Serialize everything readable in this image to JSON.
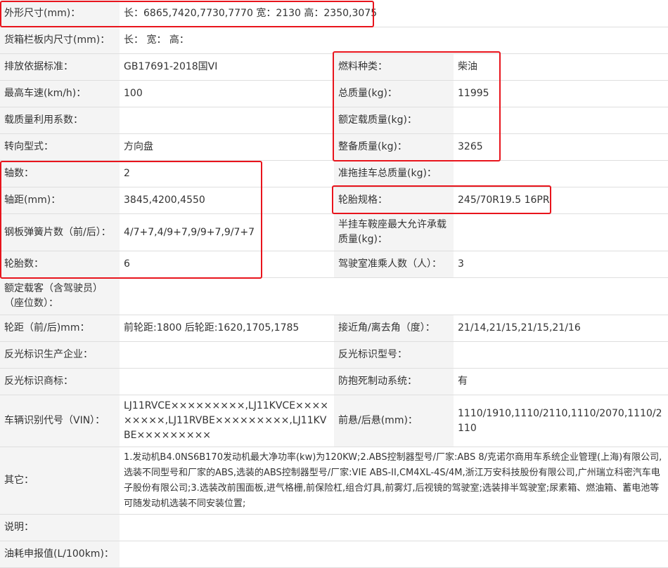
{
  "rows": {
    "r0": {
      "l1": "外形尺寸(mm)：",
      "v1": "长：6865,7420,7730,7770 宽：2130 高：2350,3075"
    },
    "r1": {
      "l1": "货箱栏板内尺寸(mm)：",
      "v1": "长： 宽： 高："
    },
    "r2": {
      "l1": "排放依据标准：",
      "v1": "GB17691-2018国VI",
      "l2": "燃料种类：",
      "v2": "柴油"
    },
    "r3": {
      "l1": "最高车速(km/h)：",
      "v1": "100",
      "l2": "总质量(kg)：",
      "v2": "11995"
    },
    "r4": {
      "l1": "载质量利用系数：",
      "v1": "",
      "l2": "额定载质量(kg)：",
      "v2": ""
    },
    "r5": {
      "l1": "转向型式：",
      "v1": "方向盘",
      "l2": "整备质量(kg)：",
      "v2": "3265"
    },
    "r6": {
      "l1": "轴数：",
      "v1": "2",
      "l2": "准拖挂车总质量(kg)：",
      "v2": ""
    },
    "r7": {
      "l1": "轴距(mm)：",
      "v1": "3845,4200,4550",
      "l2": "轮胎规格：",
      "v2": "245/70R19.5 16PR"
    },
    "r8": {
      "l1": "钢板弹簧片数（前/后）：",
      "v1": "4/7+7,4/9+7,9/9+7,9/7+7",
      "l2": "半挂车鞍座最大允许承载质量(kg)：",
      "v2": ""
    },
    "r9": {
      "l1": "轮胎数：",
      "v1": "6",
      "l2": "驾驶室准乘人数（人）：",
      "v2": "3"
    },
    "r10": {
      "l1": "额定载客（含驾驶员）（座位数）：",
      "v1": ""
    },
    "r11": {
      "l1": "轮距（前/后)mm：",
      "v1": "前轮距:1800 后轮距:1620,1705,1785",
      "l2": "接近角/离去角（度）：",
      "v2": "21/14,21/15,21/15,21/16"
    },
    "r12": {
      "l1": "反光标识生产企业：",
      "v1": "",
      "l2": "反光标识型号：",
      "v2": ""
    },
    "r13": {
      "l1": "反光标识商标：",
      "v1": "",
      "l2": "防抱死制动系统：",
      "v2": "有"
    },
    "r14": {
      "l1": "车辆识别代号（VIN）：",
      "v1": "LJ11RVCE×××××××××,LJ11KVCE×××××××××,LJ11RVBE×××××××××,LJ11KVBE×××××××××",
      "l2": "前悬/后悬(mm)：",
      "v2": "1110/1910,1110/2110,1110/2070,1110/2110"
    },
    "r15": {
      "l1": "其它：",
      "v1": "1.发动机B4.0NS6B170发动机最大净功率(kw)为120KW;2.ABS控制器型号/厂家:ABS 8/克诺尔商用车系统企业管理(上海)有限公司,选装不同型号和厂家的ABS,选装的ABS控制器型号/厂家:VIE ABS-II,CM4XL-4S/4M,浙江万安科技股份有限公司,广州瑞立科密汽车电子股份有限公司;3.选装改前围面板,进气格栅,前保险杠,组合灯具,前雾灯,后视镜的驾驶室;选装排半驾驶室;尿素箱、燃油箱、蓄电池等可随发动机选装不同安装位置;"
    },
    "r16": {
      "l1": "说明：",
      "v1": ""
    },
    "r17": {
      "l1": "油耗申报值(L/100km)：",
      "v1": ""
    }
  },
  "colors": {
    "highlight": "#e8141c",
    "label_bg": "#f4f4f4",
    "border": "#dedede",
    "text": "#333333"
  }
}
